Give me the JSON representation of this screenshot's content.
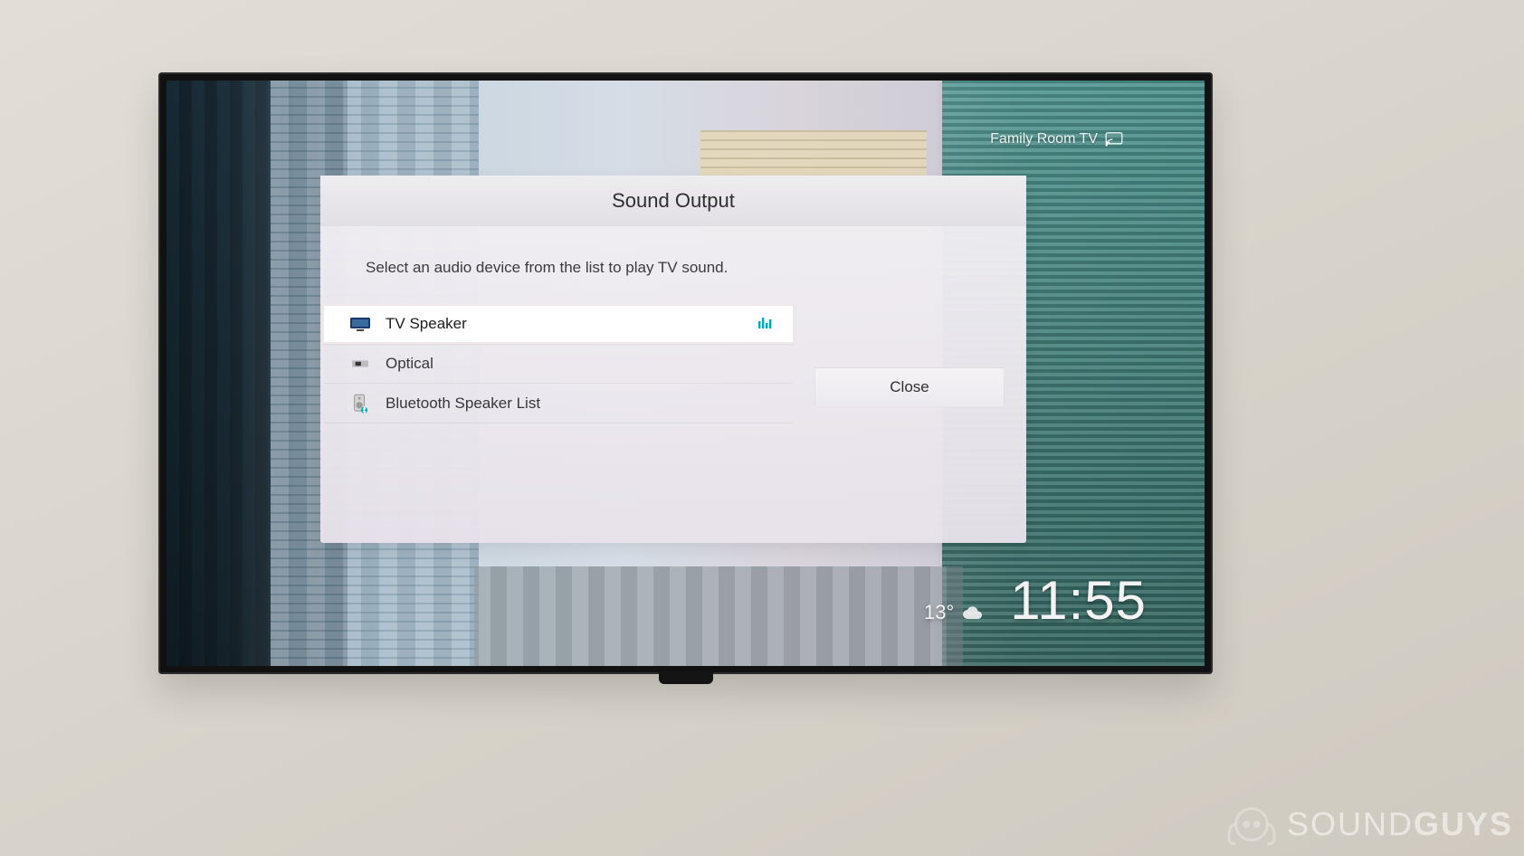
{
  "cast": {
    "label": "Family Room TV"
  },
  "clock": {
    "time": "11:55"
  },
  "weather": {
    "temp": "13°"
  },
  "panel": {
    "title": "Sound Output",
    "description": "Select an audio device from the list to play TV sound.",
    "devices": [
      {
        "label": "TV Speaker",
        "icon": "tv",
        "selected": true,
        "playing": true
      },
      {
        "label": "Optical",
        "icon": "optical",
        "selected": false,
        "playing": false
      },
      {
        "label": "Bluetooth Speaker List",
        "icon": "bt-speaker",
        "selected": false,
        "playing": false
      }
    ],
    "close_label": "Close"
  },
  "watermark": {
    "brand_a": "SOUND",
    "brand_b": "GUYS"
  }
}
